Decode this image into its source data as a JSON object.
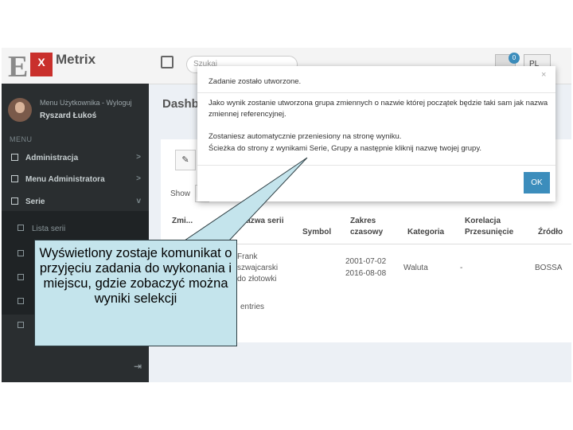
{
  "header": {
    "logo_e": "E",
    "logo_x": "X",
    "logo_text": "Metrix",
    "search_placeholder": "Szukaj",
    "cart_count": "0",
    "language": "PL"
  },
  "sidebar": {
    "user_menu": "Menu Użytkownika - Wyloguj",
    "user_name": "Ryszard Łukoś",
    "menu_header": "MENU",
    "items": [
      {
        "label": "Administracja",
        "arrow": ">"
      },
      {
        "label": "Menu Administratora",
        "arrow": ">"
      },
      {
        "label": "Serie",
        "arrow": "v"
      }
    ],
    "subitems": [
      {
        "label": "Lista serii"
      }
    ]
  },
  "main": {
    "title": "Dashboard",
    "show_label": "Show",
    "columns": [
      "Zmi...",
      "Nazwa serii",
      "Symbol",
      "Zakres czasowy",
      "Kategoria",
      "Korelacja Przesunięcie",
      "Źródło"
    ],
    "row": {
      "name": "Frank szwajcarski do złotowki",
      "range_from": "2001-07-02",
      "range_to": "2016-08-08",
      "category": "Waluta",
      "correlation": "-",
      "source": "BOSSA"
    },
    "entries_text": "entries"
  },
  "modal": {
    "title": "Zadanie zostało utworzone.",
    "close": "×",
    "p1": "Jako wynik zostanie utworzona grupa zmiennych o nazwie której początek będzie taki sam jak nazwa zmiennej referencyjnej.",
    "p2_line1": "Zostaniesz automatycznie przeniesiony na stronę wyniku.",
    "p2_line2": "Ścieżka do strony z wynikami Serie, Grupy a następnie kliknij nazwę twojej grupy.",
    "ok": "OK"
  },
  "callout": {
    "text": "Wyświetlony zostaje komunikat o przyjęciu zadania do wykonania i miejscu, gdzie zobaczyć można wyniki selekcji"
  }
}
